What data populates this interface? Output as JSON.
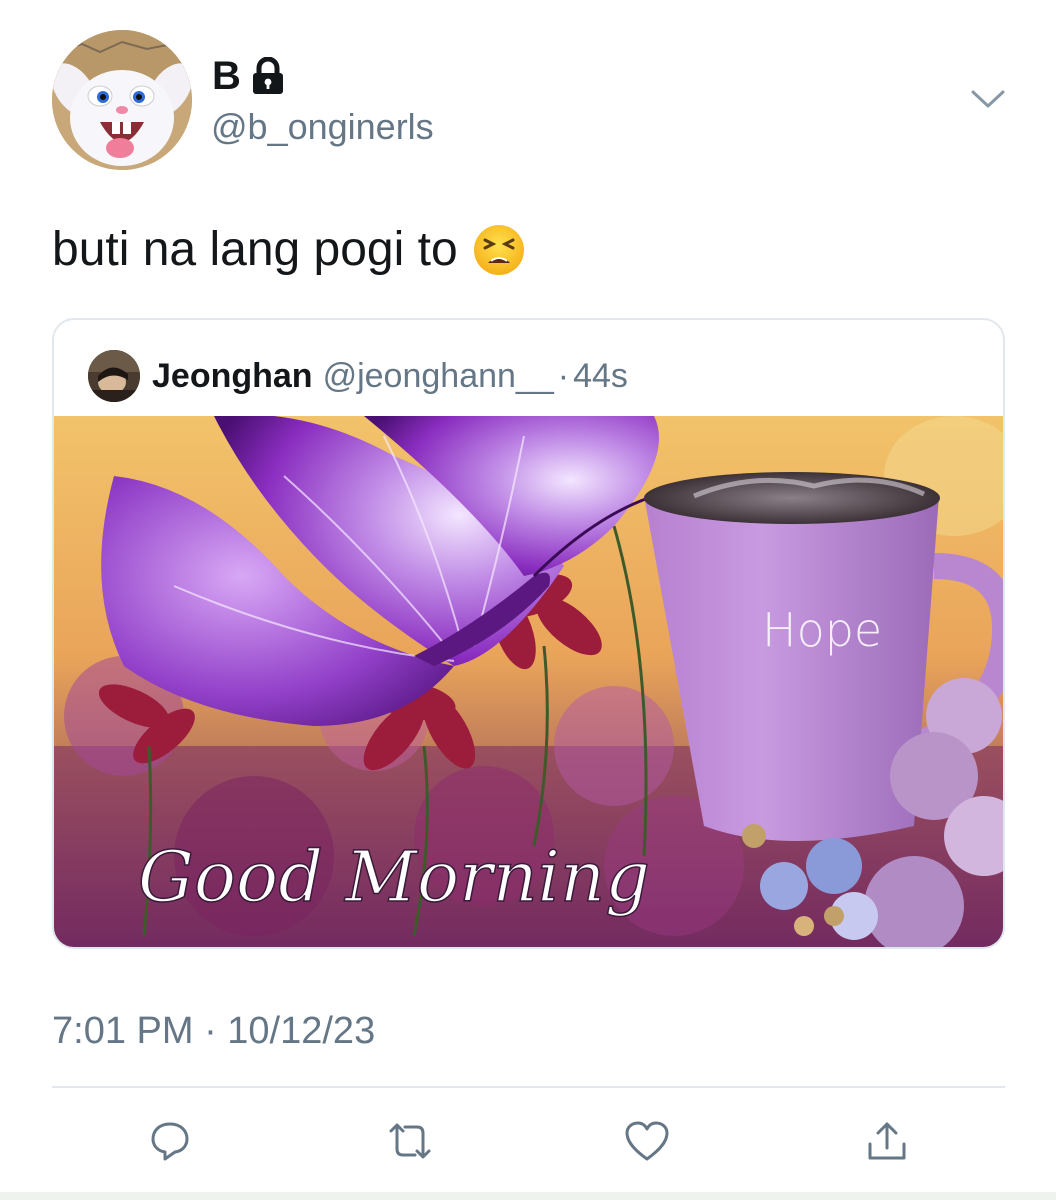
{
  "author": {
    "display_name": "B",
    "handle": "@b_onginerls",
    "protected": true
  },
  "tweet": {
    "text": "buti na lang pogi to",
    "emoji": "tired-face-emoji"
  },
  "quoted": {
    "name": "Jeonghan",
    "handle": "@jeonghann__",
    "separator": "·",
    "time": "44s",
    "image": {
      "cup_text": "Hope",
      "caption": "Good Morning"
    }
  },
  "timestamp": "7:01 PM · 10/12/23",
  "actions": {
    "reply": "reply-icon",
    "retweet": "retweet-icon",
    "like": "heart-icon",
    "share": "share-icon"
  },
  "colors": {
    "text": "#14171a",
    "secondary": "#657786",
    "border": "#e1e8ed",
    "accent_purple": "#9b59c7"
  }
}
